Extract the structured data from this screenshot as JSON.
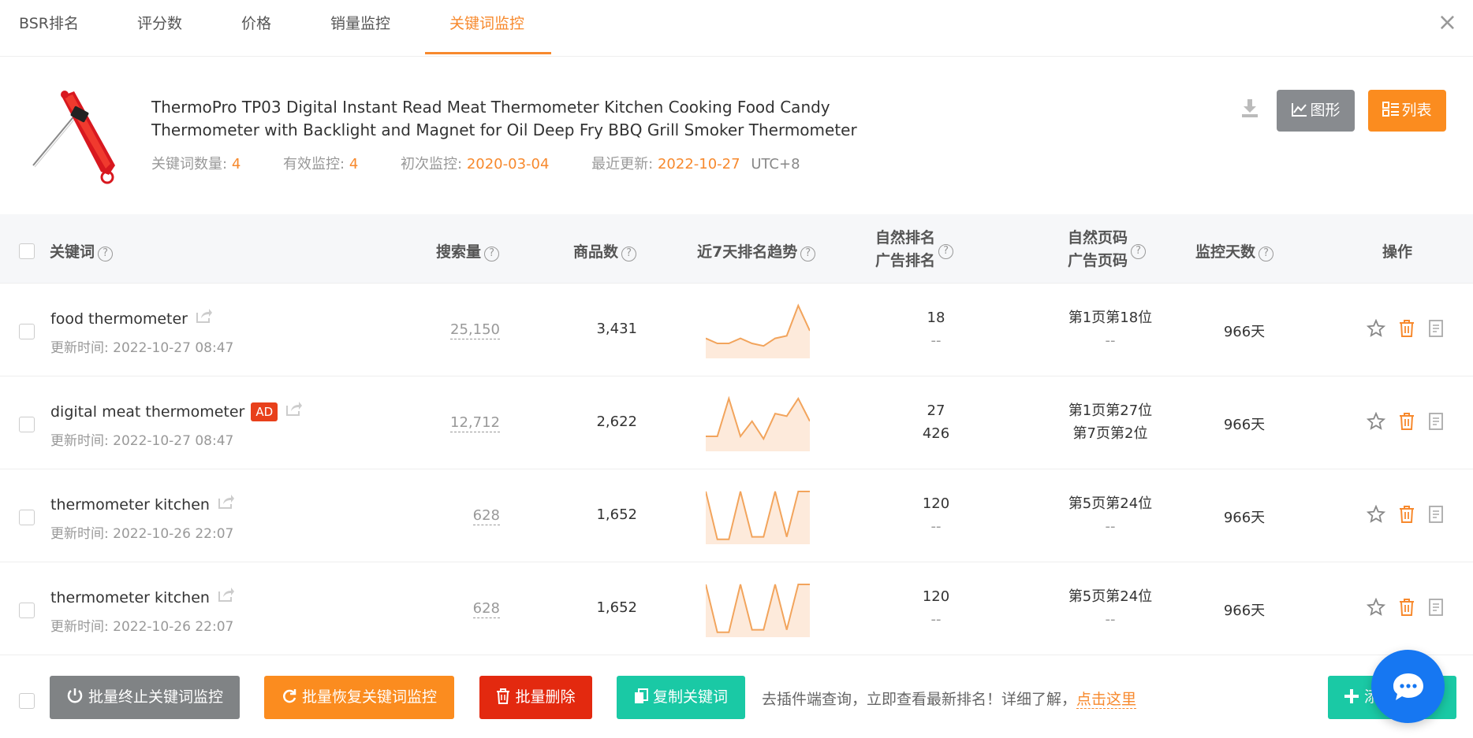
{
  "tabs": [
    {
      "label": "BSR排名"
    },
    {
      "label": "评分数"
    },
    {
      "label": "价格"
    },
    {
      "label": "销量监控"
    },
    {
      "label": "关键词监控",
      "active": true
    }
  ],
  "close_label": "×",
  "product": {
    "title_line1": "ThermoPro TP03 Digital Instant Read Meat Thermometer Kitchen Cooking Food Candy",
    "title_line2": "Thermometer with Backlight and Magnet for Oil Deep Fry BBQ Grill Smoker Thermometer",
    "meta": {
      "keyword_count_label": "关键词数量:",
      "keyword_count": "4",
      "active_label": "有效监控:",
      "active": "4",
      "first_label": "初次监控:",
      "first": "2020-03-04",
      "updated_label": "最近更新:",
      "updated": "2022-10-27",
      "timezone": "UTC+8"
    }
  },
  "view": {
    "chart_label": "图形",
    "list_label": "列表"
  },
  "table": {
    "headers": {
      "keyword": "关键词",
      "search": "搜索量",
      "goods": "商品数",
      "trend": "近7天排名趋势",
      "rank_line1": "自然排名",
      "rank_line2": "广告排名",
      "page_line1": "自然页码",
      "page_line2": "广告页码",
      "days": "监控天数",
      "ops": "操作"
    },
    "rows": [
      {
        "keyword": "food thermometer",
        "ad": "",
        "updated": "更新时间: 2022-10-27 08:47",
        "search": "25,150",
        "goods": "3,431",
        "rank1": "18",
        "rank2": "--",
        "page1": "第1页第18位",
        "page2": "--",
        "days": "966天",
        "trend": [
          0.35,
          0.25,
          0.25,
          0.35,
          0.25,
          0.2,
          0.35,
          0.4,
          1.0,
          0.5
        ]
      },
      {
        "keyword": "digital meat thermometer",
        "ad": "AD",
        "updated": "更新时间: 2022-10-27 08:47",
        "search": "12,712",
        "goods": "2,622",
        "rank1": "27",
        "rank2": "426",
        "page1": "第1页第27位",
        "page2": "第7页第2位",
        "days": "966天",
        "trend": [
          0.25,
          0.25,
          1.0,
          0.25,
          0.55,
          0.2,
          0.7,
          0.65,
          1.0,
          0.55
        ]
      },
      {
        "keyword": "thermometer kitchen",
        "ad": "",
        "updated": "更新时间: 2022-10-26 22:07",
        "search": "628",
        "goods": "1,652",
        "rank1": "120",
        "rank2": "--",
        "page1": "第5页第24位",
        "page2": "--",
        "days": "966天",
        "trend": [
          1.0,
          0.05,
          0.05,
          1.0,
          0.1,
          0.1,
          1.0,
          0.1,
          1.0,
          1.0
        ]
      },
      {
        "keyword": "thermometer kitchen",
        "ad": "",
        "updated": "更新时间: 2022-10-26 22:07",
        "search": "628",
        "goods": "1,652",
        "rank1": "120",
        "rank2": "--",
        "page1": "第5页第24位",
        "page2": "--",
        "days": "966天",
        "trend": [
          1.0,
          0.05,
          0.05,
          1.0,
          0.1,
          0.1,
          1.0,
          0.1,
          1.0,
          1.0
        ]
      }
    ]
  },
  "footer": {
    "stop_label": "批量终止关键词监控",
    "restore_label": "批量恢复关键词监控",
    "delete_label": "批量删除",
    "copy_label": "复制关键词",
    "promo_text": "去插件端查询，立即查看最新排名！详细了解，",
    "promo_link": "点击这里",
    "add_label": "添加"
  },
  "colors": {
    "accent": "#f7892d",
    "danger": "#e3290f",
    "teal": "#1ac9a5",
    "gray_btn": "#808385",
    "chat": "#1677f2"
  }
}
